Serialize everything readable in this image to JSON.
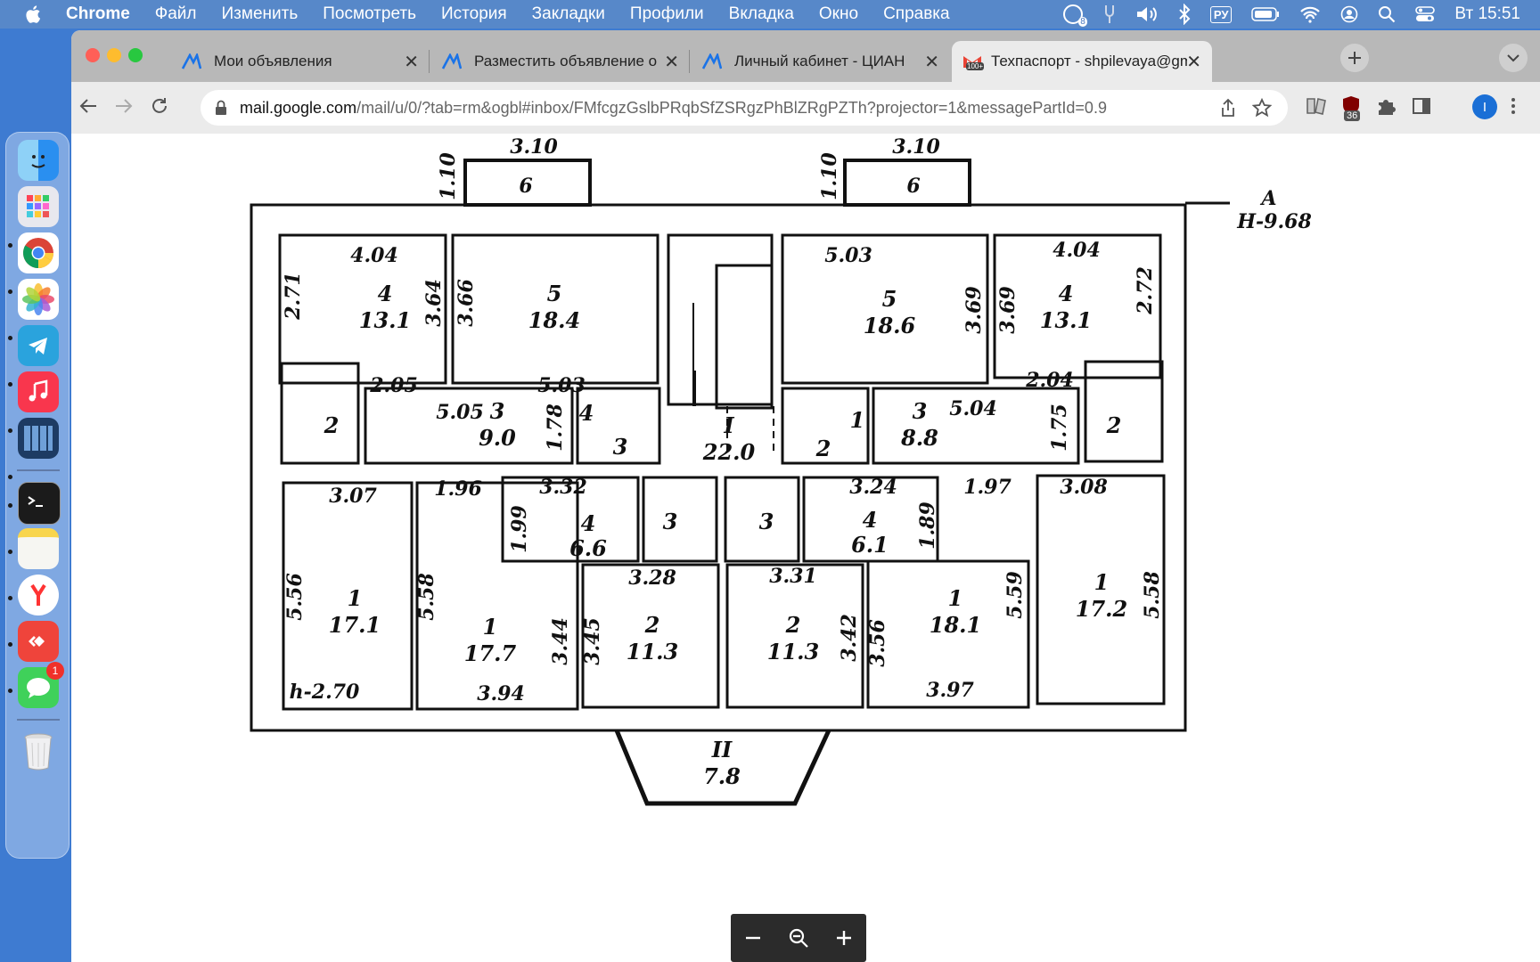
{
  "menubar": {
    "app": "Chrome",
    "items": [
      "Файл",
      "Изменить",
      "Посмотреть",
      "История",
      "Закладки",
      "Профили",
      "Вкладка",
      "Окно",
      "Справка"
    ],
    "notification_count": "8",
    "input_source": "РУ",
    "clock": "Вт  15:51"
  },
  "dock": {
    "apps": [
      "finder-icon",
      "launchpad-icon",
      "chrome-icon",
      "photos-icon",
      "telegram-icon",
      "music-icon",
      "calculator-icon",
      "terminal-icon",
      "notes-icon",
      "yandex-browser-icon",
      "anydesk-icon",
      "messages-icon",
      "trash-icon"
    ],
    "messages_badge": "1"
  },
  "tabs": [
    {
      "title": "Мои объявления",
      "active": false
    },
    {
      "title": "Разместить объявление о пр",
      "active": false
    },
    {
      "title": "Личный кабинет - ЦИАН",
      "active": false
    },
    {
      "title": "Техпаспорт - shpilevaya@gma",
      "active": true
    }
  ],
  "address_bar": {
    "domain": "mail.google.com",
    "path": "/mail/u/0/?tab=rm&ogbl#inbox/FMfcgzGslbPRqbSfZSRgzPhBlZRgPZTh?projector=1&messagePartId=0.9"
  },
  "extensions_badge": "36",
  "profile_initial": "I",
  "floor_plan": {
    "level_marker": "A",
    "elevation": "H-9.68",
    "ceiling_height": "h-2.70",
    "balconies": [
      {
        "width": "3.10",
        "depth": "1.10",
        "number": "6"
      },
      {
        "width": "3.10",
        "depth": "1.10",
        "number": "6"
      }
    ],
    "rooms": [
      {
        "number": "4",
        "area": "13.1"
      },
      {
        "number": "5",
        "area": "18.4"
      },
      {
        "number": "5",
        "area": "18.6"
      },
      {
        "number": "4",
        "area": "13.1"
      },
      {
        "number": "2",
        "area": ""
      },
      {
        "number": "3",
        "area": "9.0"
      },
      {
        "number": "4",
        "area": ""
      },
      {
        "number": "3",
        "area": ""
      },
      {
        "number": "I",
        "area": "22.0"
      },
      {
        "number": "2",
        "area": ""
      },
      {
        "number": "1",
        "area": ""
      },
      {
        "number": "3",
        "area": "8.8"
      },
      {
        "number": "2",
        "area": ""
      },
      {
        "number": "1",
        "area": "17.1"
      },
      {
        "number": "1",
        "area": "17.7"
      },
      {
        "number": "4",
        "area": "6.6"
      },
      {
        "number": "3",
        "area": ""
      },
      {
        "number": "3",
        "area": ""
      },
      {
        "number": "4",
        "area": "6.1"
      },
      {
        "number": "2",
        "area": "11.3"
      },
      {
        "number": "2",
        "area": "11.3"
      },
      {
        "number": "1",
        "area": "18.1"
      },
      {
        "number": "1",
        "area": "17.2"
      },
      {
        "number": "II",
        "area": "7.8"
      }
    ],
    "dimensions": [
      "4.04",
      "2.71",
      "3.64",
      "3.66",
      "5.03",
      "3.69",
      "3.69",
      "4.04",
      "2.72",
      "2.05",
      "5.03",
      "5.05",
      "1.78",
      "2.04",
      "5.04",
      "1.75",
      "3.07",
      "1.96",
      "3.32",
      "1.99",
      "3.24",
      "1.89",
      "1.97",
      "3.08",
      "5.56",
      "5.58",
      "3.44",
      "3.28",
      "3.45",
      "3.31",
      "3.42",
      "3.56",
      "5.59",
      "5.58",
      "3.94",
      "3.97"
    ]
  }
}
